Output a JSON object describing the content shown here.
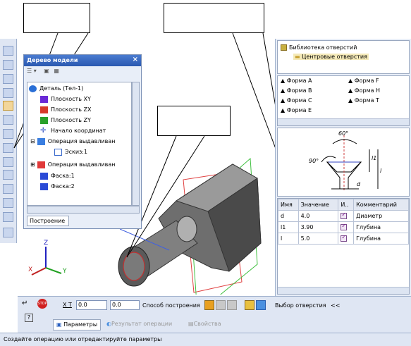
{
  "tree": {
    "title": "Дерево модели",
    "tab": "Построение",
    "items": [
      {
        "label": "Деталь (Тел-1)"
      },
      {
        "label": "Плоскость XY"
      },
      {
        "label": "Плоскость ZX"
      },
      {
        "label": "Плоскость ZY"
      },
      {
        "label": "Начало координат"
      },
      {
        "label": "Операция выдавливан"
      },
      {
        "label": "Эскиз:1"
      },
      {
        "label": "Операция выдавливан"
      },
      {
        "label": "Фаска:1"
      },
      {
        "label": "Фаска:2"
      }
    ]
  },
  "library": {
    "root": "Библиотека отверстий",
    "folder": "Центровые отверстия"
  },
  "forms": [
    "Форма A",
    "Форма F",
    "Форма B",
    "Форма H",
    "Форма C",
    "Форма T",
    "Форма E"
  ],
  "diagram": {
    "angle1": "60°",
    "angle2": "90°",
    "l1": "l1",
    "l": "l",
    "d": "d"
  },
  "params": {
    "headers": [
      "Имя",
      "Значение",
      "И..",
      "Комментарий"
    ],
    "rows": [
      {
        "name": "d",
        "value": "4.0",
        "comment": "Диаметр"
      },
      {
        "name": "l1",
        "value": "3.90",
        "comment": "Глубина"
      },
      {
        "name": "l",
        "value": "5.0",
        "comment": "Глубина"
      }
    ]
  },
  "axes": {
    "z": "Z",
    "x": "X",
    "y": "Y"
  },
  "bottom": {
    "x_label": "X T",
    "x_value": "0.0",
    "y_value": "0.0",
    "method_label": "Способ построения",
    "choose_hole": "Выбор отверстия",
    "collapse": "<<",
    "tab_params": "Параметры",
    "tab_result": "Результат операции",
    "tab_props": "Свойства",
    "stop": "STOP",
    "help": "?"
  },
  "status": "Создайте операцию или отредактируйте параметры"
}
